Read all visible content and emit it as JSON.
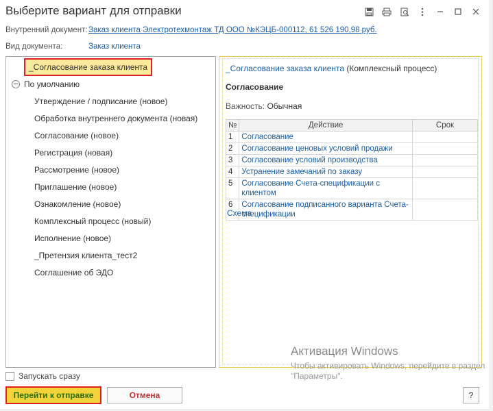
{
  "window": {
    "title": "Выберите вариант для отправки"
  },
  "title_icons": [
    "save-icon",
    "print-icon",
    "preview-icon",
    "more-icon",
    "minimize-icon",
    "maximize-icon",
    "close-icon"
  ],
  "fields": {
    "internal_doc_label": "Внутренний документ:",
    "internal_doc_value": "Заказ клиента Электротехмонтаж ТД ООО №КЭЦБ-000112, 61 526 190,98 руб.",
    "doc_type_label": "Вид документа:",
    "doc_type_value": "Заказ клиента"
  },
  "tree": {
    "selected": "_Согласование заказа клиента",
    "group": "По умолчанию",
    "items": [
      "Утверждение / подписание (новое)",
      "Обработка внутреннего документа (новая)",
      "Согласование (новое)",
      "Регистрация (новая)",
      "Рассмотрение (новое)",
      "Приглашение (новое)",
      "Ознакомление (новое)",
      "Комплексный процесс (новый)",
      "Исполнение (новое)",
      "_Претензия клиента_тест2",
      "Соглашение об  ЭДО"
    ]
  },
  "detail": {
    "process_link": "_Согласование заказа клиента",
    "process_type": "(Комплексный процесс)",
    "section_title": "Согласование",
    "importance_label": "Важность:",
    "importance_value": "Обычная",
    "table_headers": [
      "№",
      "Действие",
      "Срок"
    ],
    "rows": [
      {
        "num": "1",
        "action": "Согласование",
        "term": ""
      },
      {
        "num": "2",
        "action": "Согласование ценовых условий продажи",
        "term": ""
      },
      {
        "num": "3",
        "action": "Согласование условий производства",
        "term": ""
      },
      {
        "num": "4",
        "action": "Устранение замечаний по заказу",
        "term": ""
      },
      {
        "num": "5",
        "action": "Согласование Счета-спецификации с клиентом",
        "term": ""
      },
      {
        "num": "6",
        "action": "Согласование подписанного варианта Счета-спецификации",
        "term": ""
      }
    ],
    "schema_link": "Схема"
  },
  "footer": {
    "start_now_label": "Запускать сразу",
    "start_now_checked": false,
    "go_button": "Перейти к отправке",
    "cancel_button": "Отмена",
    "help_button": "?"
  },
  "watermark": {
    "title": "Активация Windows",
    "line1": "Чтобы активировать Windows, перейдите в раздел",
    "line2": "\"Параметры\"."
  },
  "colors": {
    "link": "#1a5ea8",
    "highlight_yellow": "#f3d33a",
    "selection_fill": "#fbe99c",
    "red_outline": "#e02020",
    "go_text": "#2a6e00",
    "cancel_text": "#c03030"
  }
}
